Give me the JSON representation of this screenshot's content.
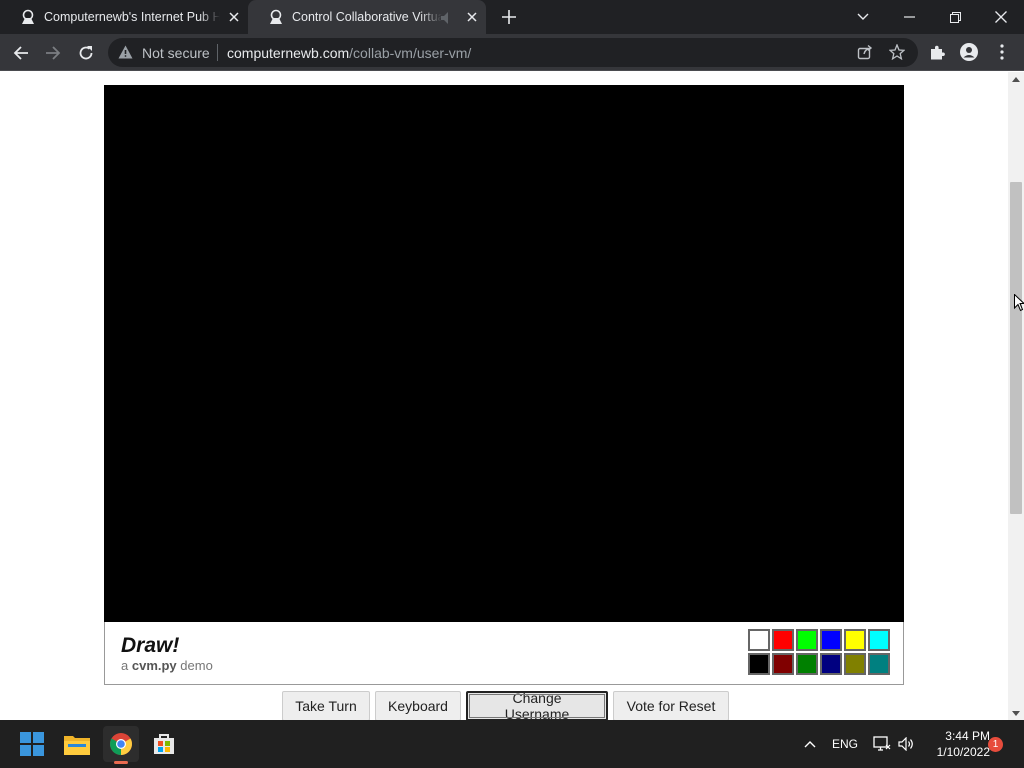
{
  "browser": {
    "tabs": [
      {
        "title": "Computernewb's Internet Pub Hub",
        "active": false
      },
      {
        "title": "Control Collaborative Virtual Machines",
        "active": true
      }
    ],
    "omnibox": {
      "security_label": "Not secure",
      "url_host": "computernewb.com",
      "url_path": "/collab-vm/user-vm/"
    }
  },
  "page": {
    "app_title": "Draw!",
    "subtitle_prefix": "a",
    "subtitle_brand": "cvm.py",
    "subtitle_suffix": "demo",
    "palette": {
      "row1": [
        "#ffffff",
        "#ff0000",
        "#00ff00",
        "#0000ff",
        "#ffff00",
        "#00ffff"
      ],
      "row2": [
        "#000000",
        "#800000",
        "#008000",
        "#000080",
        "#808000",
        "#008080"
      ]
    },
    "buttons": {
      "take_turn": "Take Turn",
      "keyboard": "Keyboard",
      "change_username": "Change Username",
      "vote_reset": "Vote for Reset"
    }
  },
  "taskbar": {
    "language": "ENG",
    "time": "3:44 PM",
    "date": "1/10/2022",
    "notification_count": "1"
  }
}
